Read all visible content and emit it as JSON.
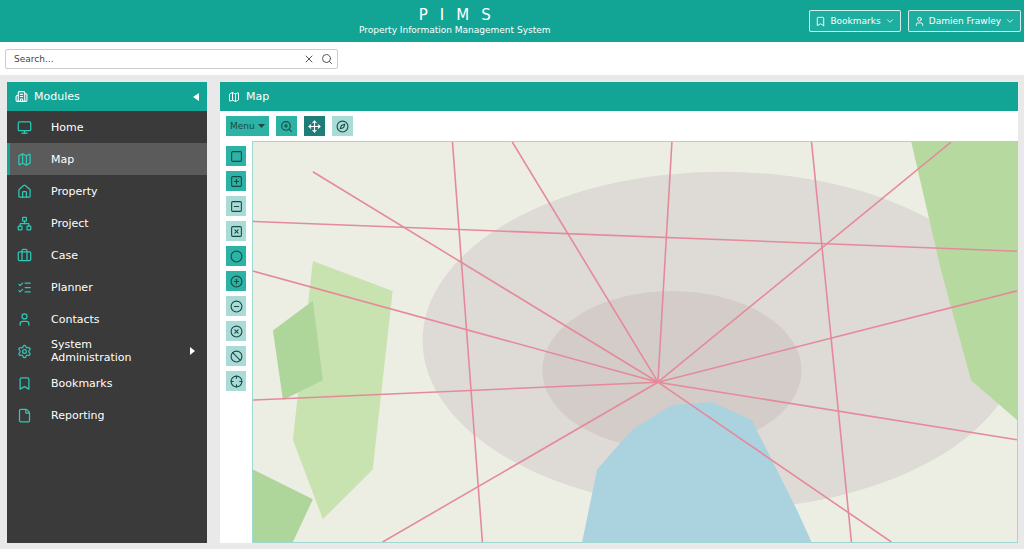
{
  "header": {
    "title": "PIMS",
    "subtitle": "Property Information Management System",
    "bookmarks": "Bookmarks",
    "user": "Damien Frawley"
  },
  "search": {
    "placeholder": "Search..."
  },
  "sidebar": {
    "title": "Modules",
    "items": [
      {
        "label": "Home",
        "selected": false,
        "expandable": false
      },
      {
        "label": "Map",
        "selected": true,
        "expandable": false
      },
      {
        "label": "Property",
        "selected": false,
        "expandable": false
      },
      {
        "label": "Project",
        "selected": false,
        "expandable": false
      },
      {
        "label": "Case",
        "selected": false,
        "expandable": false
      },
      {
        "label": "Planner",
        "selected": false,
        "expandable": false
      },
      {
        "label": "Contacts",
        "selected": false,
        "expandable": false
      },
      {
        "label": "System Administration",
        "selected": false,
        "expandable": true
      },
      {
        "label": "Bookmarks",
        "selected": false,
        "expandable": false
      },
      {
        "label": "Reporting",
        "selected": false,
        "expandable": false
      }
    ]
  },
  "panel": {
    "title": "Map",
    "menu": "Menu",
    "tools": [
      {
        "kind": "zoom",
        "selected": false,
        "disabled": false
      },
      {
        "kind": "pan",
        "selected": true,
        "disabled": false
      },
      {
        "kind": "compass",
        "selected": false,
        "disabled": true
      }
    ],
    "draw_tools": [
      {
        "kind": "rectangle",
        "disabled": false
      },
      {
        "kind": "rectangle-add",
        "disabled": false
      },
      {
        "kind": "rectangle-remove",
        "disabled": true
      },
      {
        "kind": "rectangle-clear",
        "disabled": true
      },
      {
        "kind": "circle",
        "disabled": false
      },
      {
        "kind": "circle-add",
        "disabled": false
      },
      {
        "kind": "circle-remove",
        "disabled": true
      },
      {
        "kind": "circle-clear",
        "disabled": true
      },
      {
        "kind": "cancel",
        "disabled": true
      },
      {
        "kind": "locate",
        "disabled": true
      }
    ]
  }
}
